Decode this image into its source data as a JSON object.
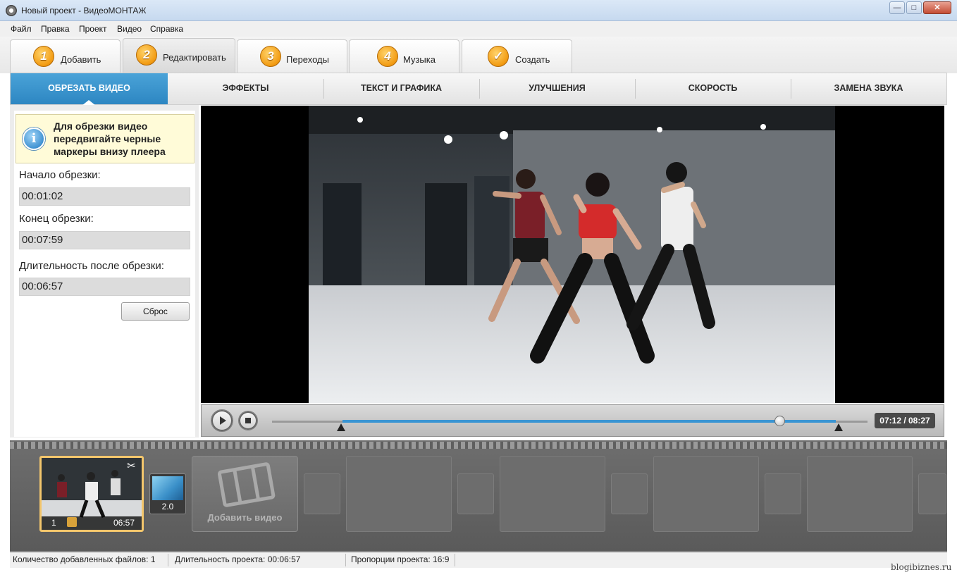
{
  "window": {
    "title": "Новый проект - ВидеоМОНТАЖ",
    "controls": {
      "minimize": "—",
      "maximize": "□",
      "close": "✕"
    }
  },
  "menu": [
    "Файл",
    "Правка",
    "Проект",
    "Видео",
    "Справка"
  ],
  "steps": [
    {
      "num": "1",
      "label": "Добавить"
    },
    {
      "num": "2",
      "label": "Редактировать"
    },
    {
      "num": "3",
      "label": "Переходы"
    },
    {
      "num": "4",
      "label": "Музыка"
    },
    {
      "num": "✓",
      "label": "Создать"
    }
  ],
  "subtabs": [
    "ОБРЕЗАТЬ ВИДЕО",
    "ЭФФЕКТЫ",
    "ТЕКСТ И ГРАФИКА",
    "УЛУЧШЕНИЯ",
    "СКОРОСТЬ",
    "ЗАМЕНА ЗВУКА"
  ],
  "trim": {
    "hint": "Для обрезки видео передвигайте черные маркеры внизу плеера",
    "start_label": "Начало обрезки:",
    "start_value": "00:01:02",
    "end_label": "Конец обрезки:",
    "end_value": "00:07:59",
    "duration_label": "Длительность после обрезки:",
    "duration_value": "00:06:57",
    "reset_label": "Сброс"
  },
  "player": {
    "time": "07:12 / 08:27",
    "position_fraction": 0.852
  },
  "storyboard": {
    "clip": {
      "index": "1",
      "duration": "06:57"
    },
    "transition": {
      "duration": "2.0"
    },
    "add_video_label": "Добавить видео"
  },
  "status": {
    "files": "Количество добавленных файлов: 1",
    "duration": "Длительность проекта:  00:06:57",
    "aspect": "Пропорции проекта:  16:9"
  },
  "watermark": "blogibiznes.ru",
  "colors": {
    "accent": "#2d86c2",
    "step_badge": "#f29b12",
    "clip_border": "#f3c66c"
  }
}
